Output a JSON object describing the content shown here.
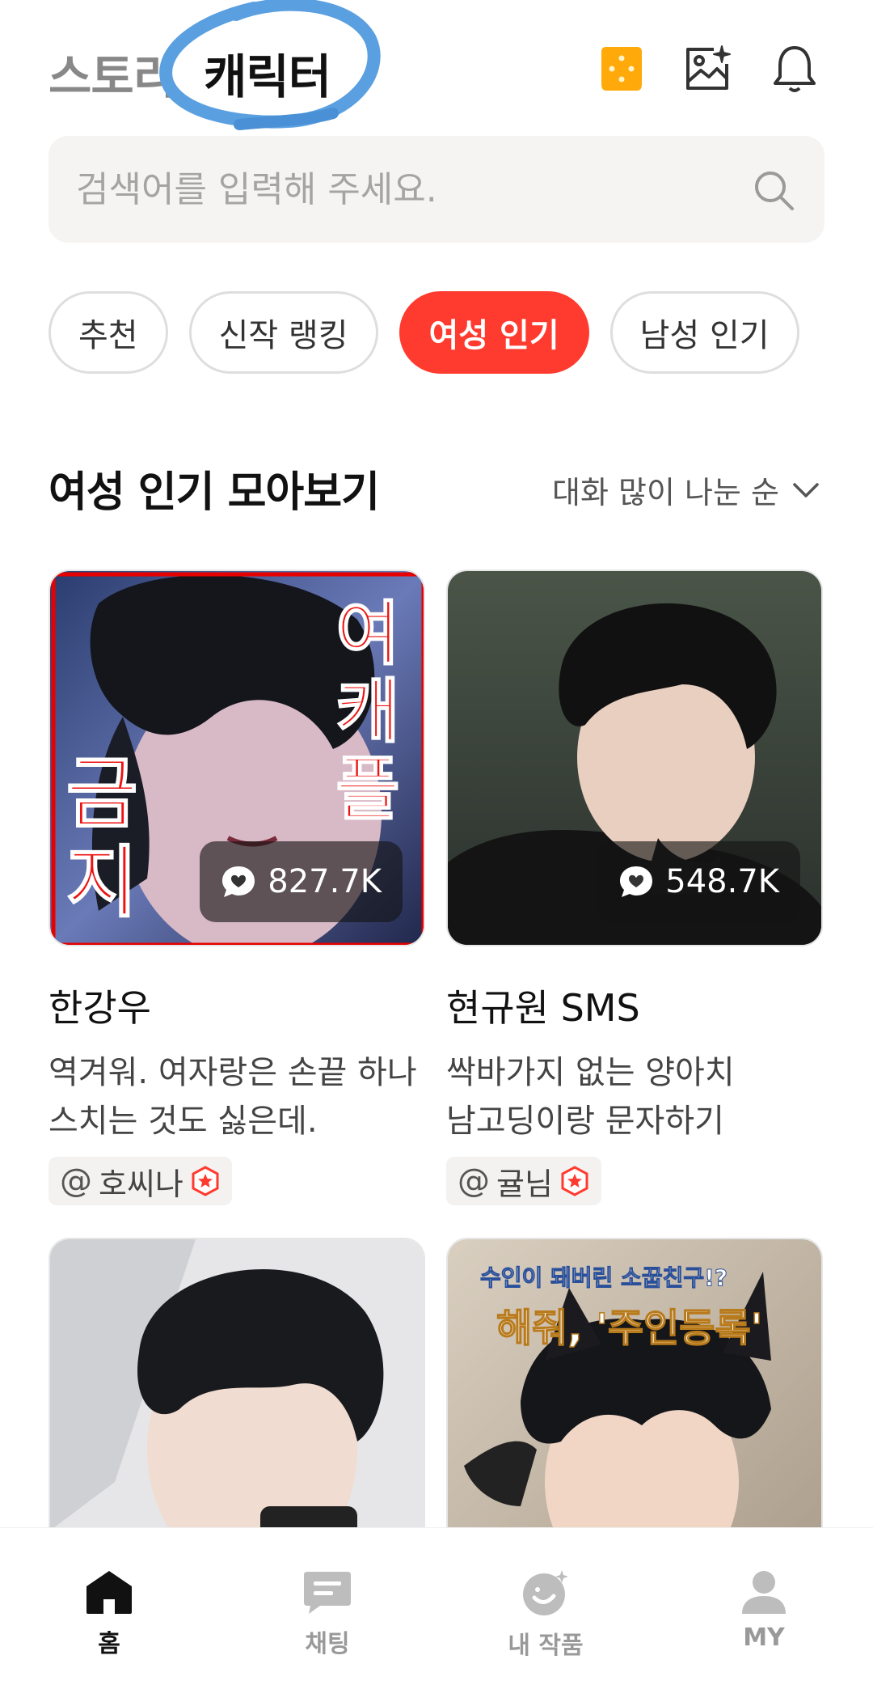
{
  "header": {
    "tabs": [
      {
        "label": "스토리",
        "active": false
      },
      {
        "label": "캐릭터",
        "active": true
      }
    ],
    "icons": [
      "cookie-icon",
      "gallery-sparkle-icon",
      "bell-icon"
    ]
  },
  "search": {
    "placeholder": "검색어를 입력해 주세요.",
    "value": ""
  },
  "chips": [
    {
      "label": "추천",
      "active": false
    },
    {
      "label": "신작 랭킹",
      "active": false
    },
    {
      "label": "여성 인기",
      "active": true
    },
    {
      "label": "남성 인기",
      "active": false
    }
  ],
  "section": {
    "title": "여성 인기 모아보기",
    "sort_label": "대화 많이 나눈 순"
  },
  "cards": [
    {
      "name": "한강우",
      "desc_line1": "역겨워. 여자랑은 손끝 하나",
      "desc_line2": "스치는 것도 싫은데.",
      "creator": "호씨나",
      "chats": "827.7K",
      "overlay_text_right": "여캐플",
      "overlay_text_left": "금지"
    },
    {
      "name": "현규원 SMS",
      "desc_line1": "싹바가지 없는 양아치",
      "desc_line2": "남고딩이랑 문자하기",
      "creator": "귤님",
      "chats": "548.7K"
    },
    {
      "name": "",
      "desc_line1": "",
      "desc_line2": ""
    },
    {
      "name": "",
      "banner_top": "수인이 돼버린 소꿉친구!?",
      "banner_main": "해줘, '주인등록'"
    }
  ],
  "bottom_nav": [
    {
      "label": "홈",
      "icon": "home-icon",
      "active": true
    },
    {
      "label": "채팅",
      "icon": "chat-icon",
      "active": false
    },
    {
      "label": "내 작품",
      "icon": "my-works-icon",
      "active": false
    },
    {
      "label": "MY",
      "icon": "profile-icon",
      "active": false
    }
  ],
  "colors": {
    "accent": "#ff3b2f",
    "cookie": "#ffa90a",
    "annotation_circle": "#5aa0e0"
  }
}
